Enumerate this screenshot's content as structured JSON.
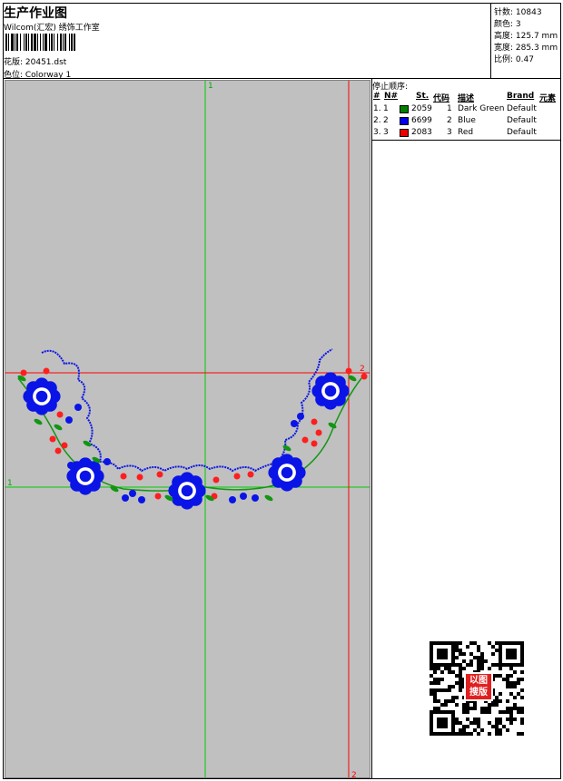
{
  "header": {
    "title": "生产作业图",
    "company": "Wilcom(汇宏) 绣饰工作室",
    "design_label": "花版: 20451.dst",
    "colorway_label": "色位: Colorway 1"
  },
  "stats": [
    {
      "label": "针数:",
      "value": "10843"
    },
    {
      "label": "颜色:",
      "value": "3"
    },
    {
      "label": "高度:",
      "value": "125.7 mm"
    },
    {
      "label": "宽度:",
      "value": "285.3 mm"
    },
    {
      "label": "比例:",
      "value": "0.47"
    }
  ],
  "panel": {
    "title": "停止顺序:",
    "columns": {
      "hash": "#",
      "num": "N#",
      "st": "St.",
      "code": "代码",
      "desc": "描述",
      "brand": "Brand",
      "elem": "元素"
    },
    "rows": [
      {
        "idx": "1.",
        "n": "1",
        "color": "#008000",
        "st": "2059",
        "code": "1",
        "desc": "Dark Green",
        "brand": "Default"
      },
      {
        "idx": "2.",
        "n": "2",
        "color": "#0000ee",
        "st": "6699",
        "code": "2",
        "desc": "Blue",
        "brand": "Default"
      },
      {
        "idx": "3.",
        "n": "3",
        "color": "#ee0000",
        "st": "2083",
        "code": "3",
        "desc": "Red",
        "brand": "Default"
      }
    ]
  },
  "canvas": {
    "axis_labels": {
      "green_top": "1",
      "green_left": "1",
      "red_right": "2",
      "red_bottom": "2"
    },
    "colors": {
      "background": "#c0c0c0",
      "green_axis": "#00cc00",
      "red_axis": "#ff0000",
      "blue": "#0a14e6",
      "red": "#ff1e1e",
      "green": "#129612"
    }
  },
  "qr": {
    "stamp_text": "以图搜版"
  }
}
